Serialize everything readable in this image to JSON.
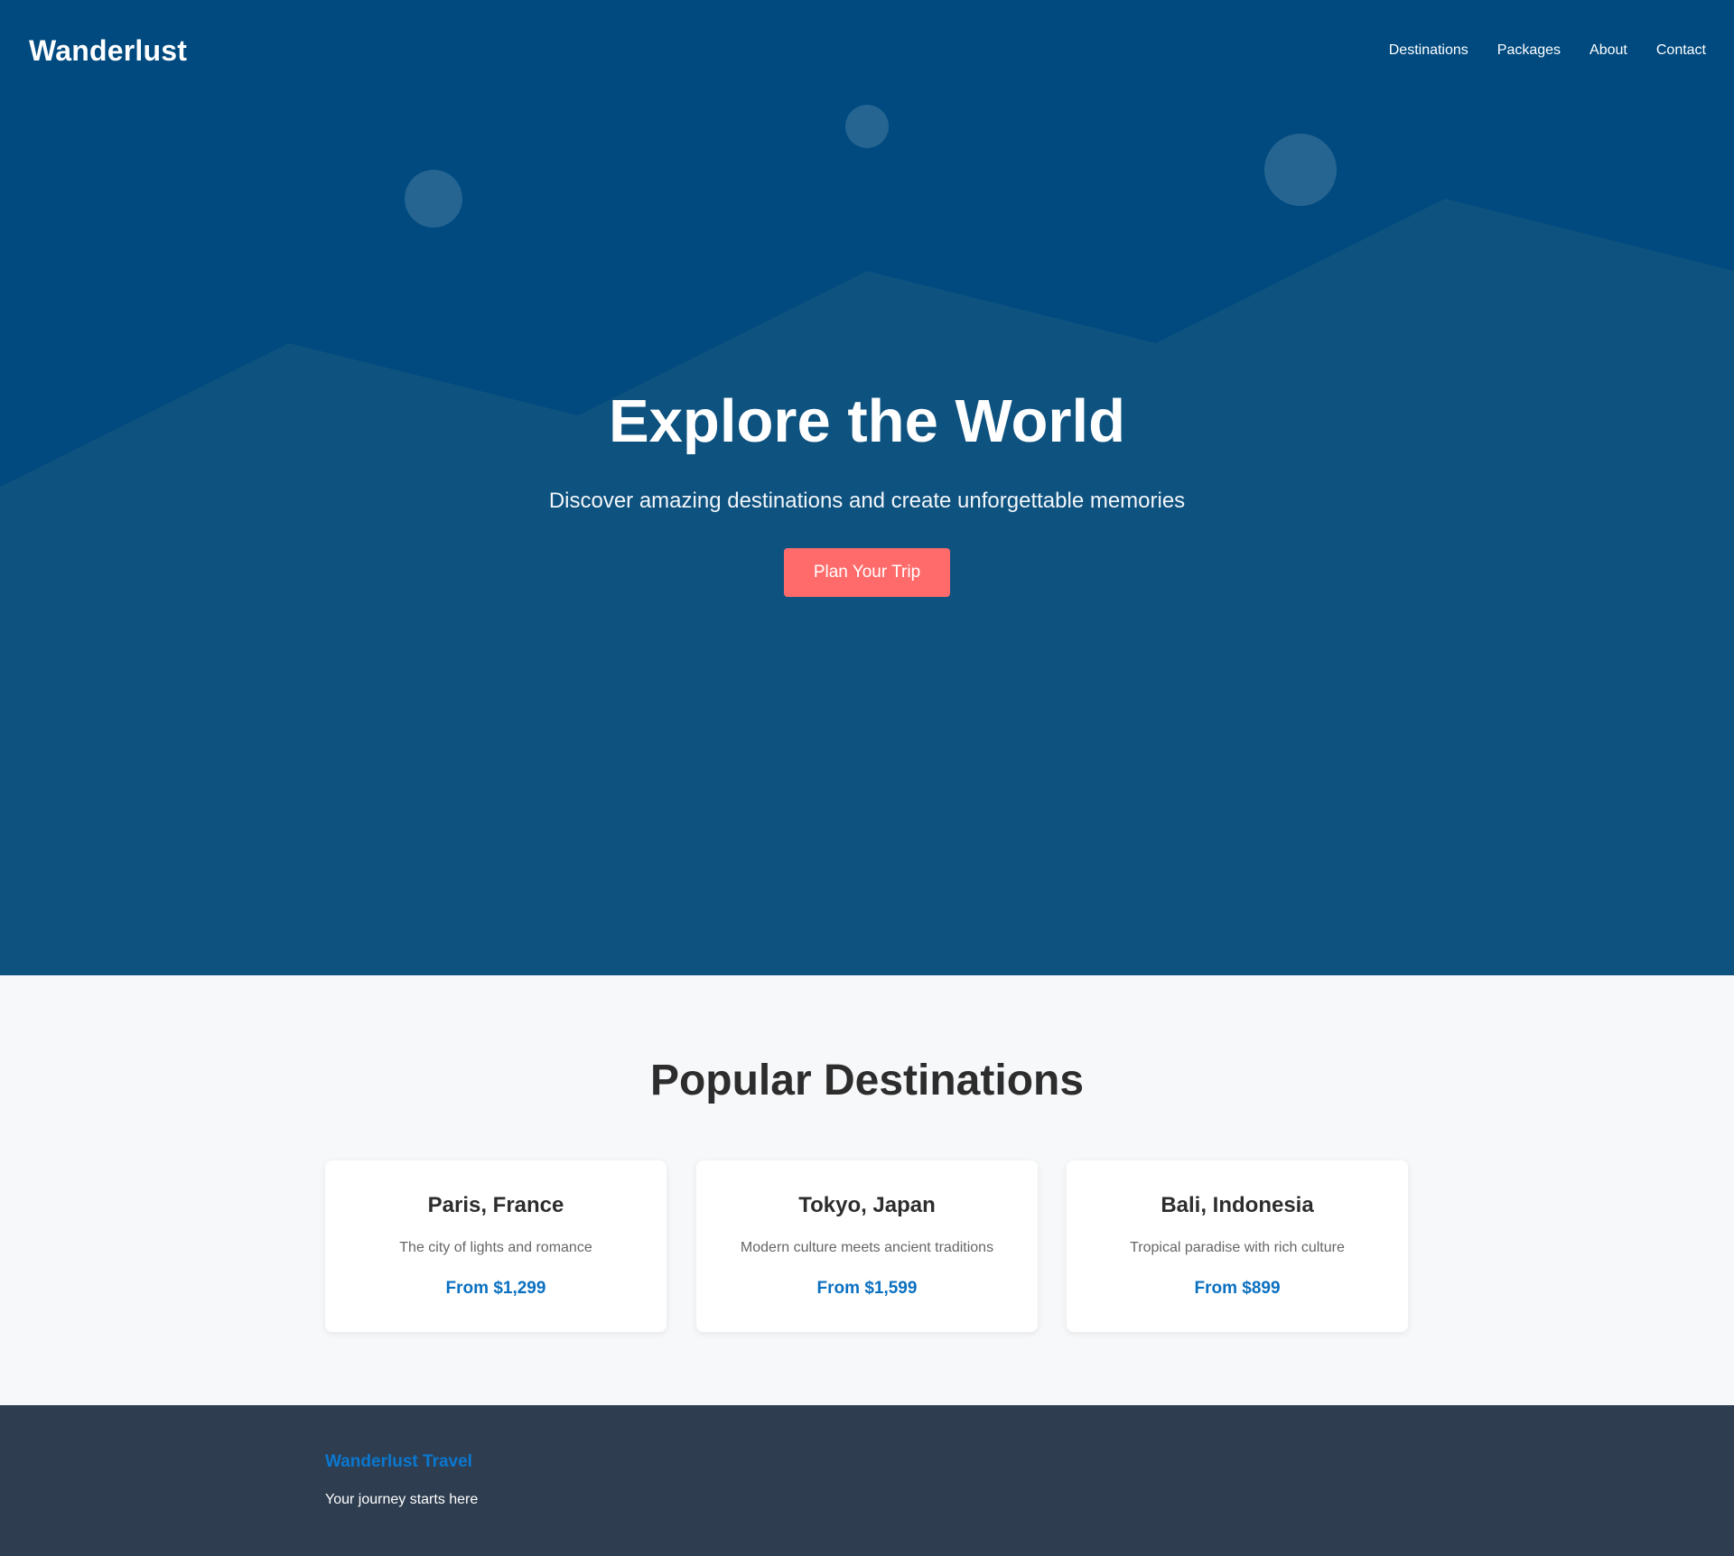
{
  "brand": {
    "logo": "Wanderlust"
  },
  "nav": {
    "links": [
      "Destinations",
      "Packages",
      "About",
      "Contact"
    ]
  },
  "hero": {
    "title": "Explore the World",
    "subtitle": "Discover amazing destinations and create unforgettable memories",
    "cta_label": "Plan Your Trip"
  },
  "destinations": {
    "title": "Popular Destinations",
    "cards": [
      {
        "name": "Paris, France",
        "description": "The city of lights and romance",
        "price": "From $1,299"
      },
      {
        "name": "Tokyo, Japan",
        "description": "Modern culture meets ancient traditions",
        "price": "From $1,599"
      },
      {
        "name": "Bali, Indonesia",
        "description": "Tropical paradise with rich culture",
        "price": "From $899"
      }
    ]
  },
  "footer": {
    "title": "Wanderlust Travel",
    "tagline": "Your journey starts here"
  },
  "colors": {
    "hero_sky": "#004a7f",
    "hero_mountains": "#0e527f",
    "cta": "#ff6b6b",
    "price": "#0a70c0",
    "footer_bg": "#2e3d50",
    "footer_title": "#0a78d0"
  }
}
